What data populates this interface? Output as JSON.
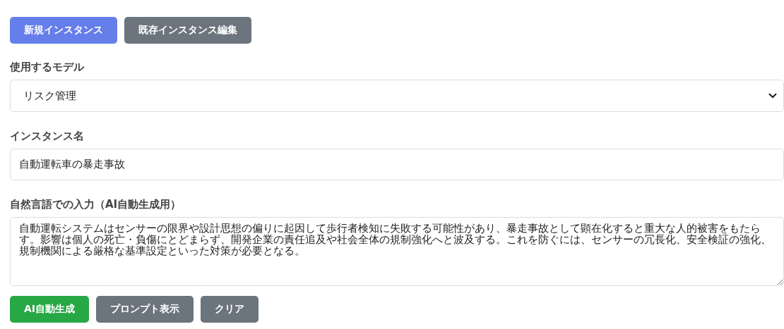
{
  "mode_tabs": [
    {
      "label": "新規インスタンス",
      "selected": true
    },
    {
      "label": "既存インスタンス編集",
      "selected": false
    }
  ],
  "model": {
    "label": "使用するモデル",
    "value": "リスク管理"
  },
  "instance_name": {
    "label": "インスタンス名",
    "value": "自動運転車の暴走事故"
  },
  "natural_input": {
    "label": "自然言語での入力（AI自動生成用）",
    "value": "自動運転システムはセンサーの限界や設計思想の偏りに起因して歩行者検知に失敗する可能性があり、暴走事故として顕在化すると重大な人的被害をもたらす。影響は個人の死亡・負傷にとどまらず、開発企業の責任追及や社会全体の規制強化へと波及する。これを防ぐには、センサーの冗長化、安全検証の強化、規制機関による厳格な基準設定といった対策が必要となる。"
  },
  "actions": [
    {
      "label": "AI自動生成",
      "kind": "primary"
    },
    {
      "label": "プロンプト表示",
      "kind": "secondary"
    },
    {
      "label": "クリア",
      "kind": "secondary"
    }
  ]
}
